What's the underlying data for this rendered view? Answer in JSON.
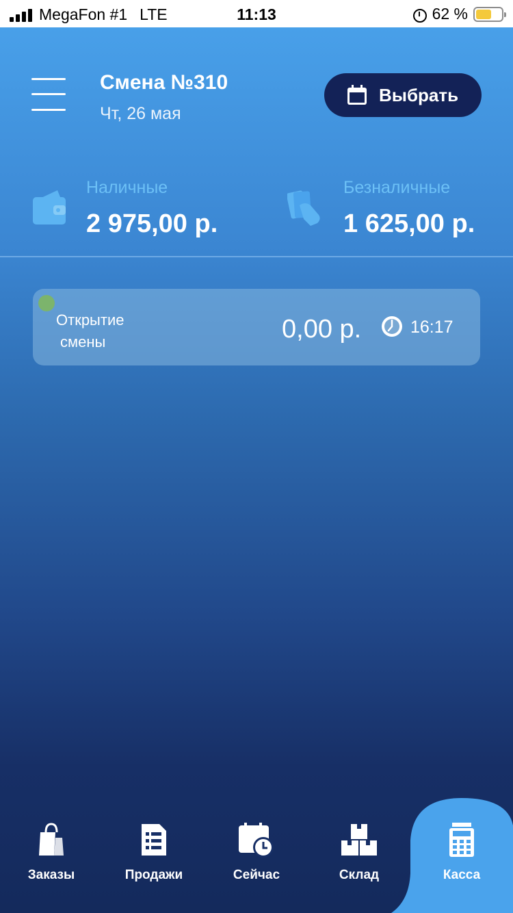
{
  "status_bar": {
    "carrier": "MegaFon #1",
    "network": "LTE",
    "time": "11:13",
    "battery": "62 %"
  },
  "header": {
    "title": "Смена №310",
    "date": "Чт, 26 мая",
    "select_label": "Выбрать"
  },
  "stats": {
    "cash_label": "Наличные",
    "cash_value": "2 975,00 р.",
    "cashless_label": "Безналичные",
    "cashless_value": "1 625,00 р."
  },
  "events": [
    {
      "label_line1": "Открытие",
      "label_line2": "смены",
      "amount": "0,00 р.",
      "time": "16:17",
      "status_color": "#7cb46c"
    }
  ],
  "tabs": [
    {
      "label": "Заказы",
      "icon": "shopping-bag-icon",
      "active": false
    },
    {
      "label": "Продажи",
      "icon": "receipt-icon",
      "active": false
    },
    {
      "label": "Сейчас",
      "icon": "calendar-clock-icon",
      "active": false
    },
    {
      "label": "Склад",
      "icon": "boxes-icon",
      "active": false
    },
    {
      "label": "Касса",
      "icon": "cash-register-icon",
      "active": true
    }
  ],
  "colors": {
    "accent_dark": "#132257",
    "label_blue": "#6cc0f6",
    "active_tab": "#4aa3ec",
    "tabbar_bg": "#142a5c"
  }
}
